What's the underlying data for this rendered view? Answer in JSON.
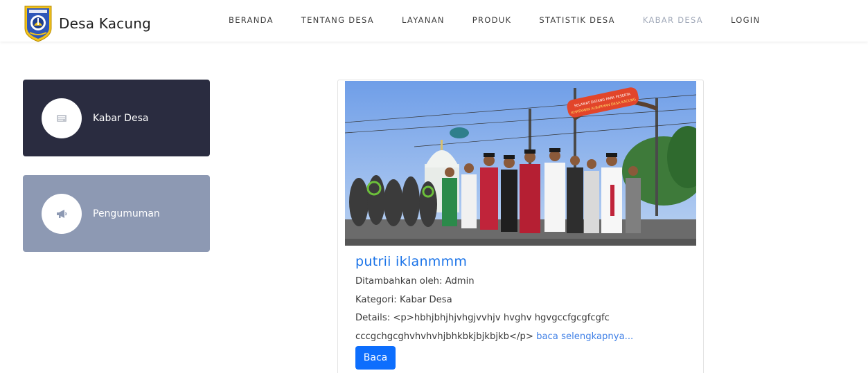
{
  "header": {
    "brand": "Desa Kacung",
    "nav": [
      {
        "label": "BERANDA"
      },
      {
        "label": "TENTANG DESA"
      },
      {
        "label": "LAYANAN"
      },
      {
        "label": "PRODUK"
      },
      {
        "label": "STATISTIK DESA"
      },
      {
        "label": "KABAR DESA"
      },
      {
        "label": "LOGIN"
      }
    ],
    "active_nav": "KABAR DESA"
  },
  "sidebar": {
    "items": [
      {
        "label": "Kabar Desa",
        "icon": "newspaper-icon"
      },
      {
        "label": "Pengumuman",
        "icon": "megaphone-icon"
      }
    ]
  },
  "post": {
    "title": "putrii iklanmmm",
    "added_by": "Ditambahkan oleh: Admin",
    "category": "Kategori: Kabar Desa",
    "details_line1": "Details: <p>hbhjbhjhjvhgjvvhjv hvghv hgvgccfgcgfcgfc",
    "details_line2": "cccgchgcghvhvhvhjbhkbkjbjkbjkb</p>",
    "read_more": "baca selengkapnya...",
    "button_label": "Baca",
    "banner_text": "SELAMAT DATANG PARA PESERTA KHATAMAN ALBURHAN DESA KACUNG"
  },
  "colors": {
    "sidebar_dark": "#2a2c40",
    "sidebar_light": "#8d99b3",
    "link_blue": "#1a73e8",
    "button_blue": "#0d6efd",
    "nav_active": "#a0a8b8"
  }
}
